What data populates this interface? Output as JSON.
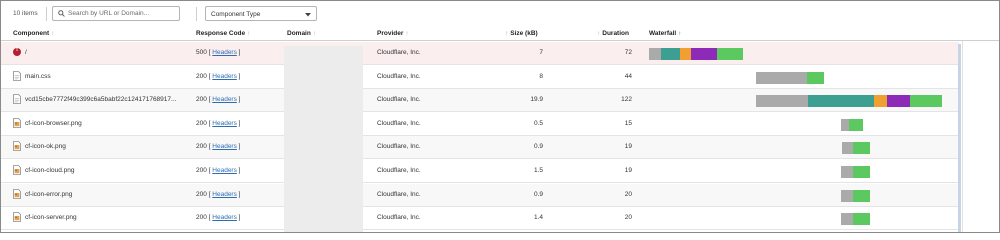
{
  "toolbar": {
    "item_count": "10 items",
    "search_placeholder": "Search by URL or Domain...",
    "filter_label": "Component Type"
  },
  "columns": {
    "component": "Component",
    "response_code": "Response Code",
    "domain": "Domain",
    "provider": "Provider",
    "size": "Size (kB)",
    "duration": "Duration",
    "waterfall": "Waterfall"
  },
  "colors": {
    "queue": "#aaaaaa",
    "connect": "#3d9e92",
    "ssl": "#f0a030",
    "wait": "#8e2ab8",
    "receive": "#5cc960",
    "link": "#2e6db4",
    "error": "#b5202e"
  },
  "rows": [
    {
      "component": "/",
      "icon": "error-icon",
      "code": "500",
      "headers_label": "Headers",
      "provider": "Cloudflare, Inc.",
      "size": "7",
      "duration": "72"
    },
    {
      "component": "main.css",
      "icon": "css-file-icon",
      "code": "200",
      "headers_label": "Headers",
      "provider": "Cloudflare, Inc.",
      "size": "8",
      "duration": "44"
    },
    {
      "component": "vcd15cbe7772f49c399c6a5babf22c124171768917...",
      "icon": "file-icon",
      "code": "200",
      "headers_label": "Headers",
      "provider": "Cloudflare, Inc.",
      "size": "19.9",
      "duration": "122"
    },
    {
      "component": "cf-icon-browser.png",
      "icon": "image-file-icon",
      "code": "200",
      "headers_label": "Headers",
      "provider": "Cloudflare, Inc.",
      "size": "0.5",
      "duration": "15"
    },
    {
      "component": "cf-icon-ok.png",
      "icon": "image-file-icon",
      "code": "200",
      "headers_label": "Headers",
      "provider": "Cloudflare, Inc.",
      "size": "0.9",
      "duration": "19"
    },
    {
      "component": "cf-icon-cloud.png",
      "icon": "image-file-icon",
      "code": "200",
      "headers_label": "Headers",
      "provider": "Cloudflare, Inc.",
      "size": "1.5",
      "duration": "19"
    },
    {
      "component": "cf-icon-error.png",
      "icon": "image-file-icon",
      "code": "200",
      "headers_label": "Headers",
      "provider": "Cloudflare, Inc.",
      "size": "0.9",
      "duration": "20"
    },
    {
      "component": "cf-icon-server.png",
      "icon": "image-file-icon",
      "code": "200",
      "headers_label": "Headers",
      "provider": "Cloudflare, Inc.",
      "size": "1.4",
      "duration": "20"
    }
  ]
}
